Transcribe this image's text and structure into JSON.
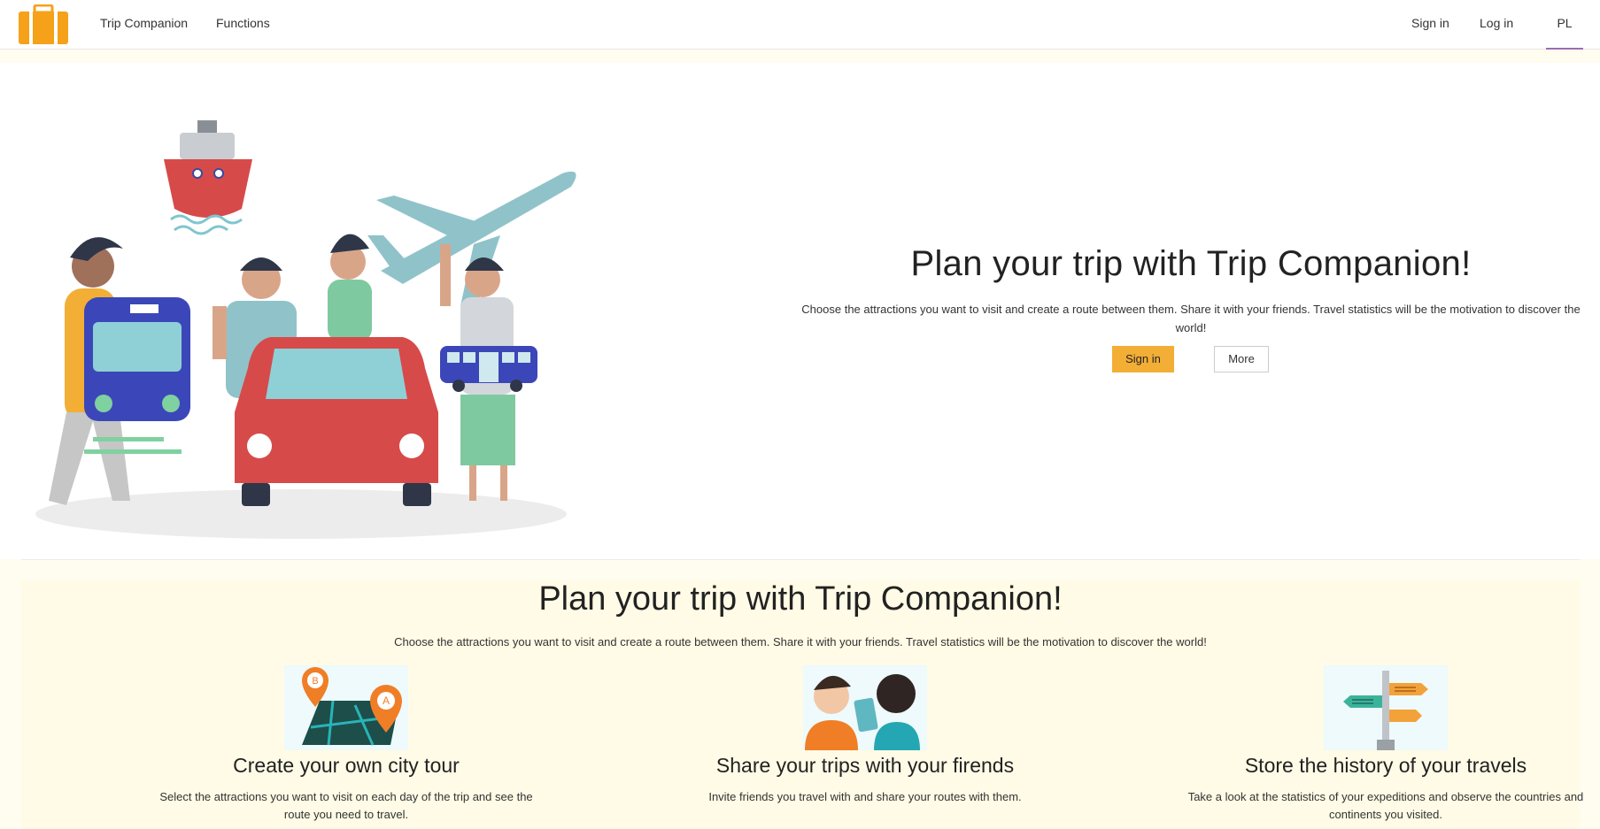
{
  "navbar": {
    "brand": "Trip Companion",
    "functions": "Functions",
    "sign_in": "Sign in",
    "log_in": "Log in",
    "language": "PL"
  },
  "hero": {
    "title": "Plan your trip with Trip Companion!",
    "description": "Choose the attractions you want to visit and create a route between them. Share it with your friends. Travel statistics will be the motivation to discover the world!",
    "sign_in_button": "Sign in",
    "more_button": "More"
  },
  "features": {
    "title": "Plan your trip with Trip Companion!",
    "description": "Choose the attractions you want to visit and create a route between them. Share it with your friends. Travel statistics will be the motivation to discover the world!",
    "items": [
      {
        "title": "Create your own city tour",
        "description": "Select the attractions you want to visit on each day of the trip and see the route you need to travel.",
        "icon": "map-pins-icon"
      },
      {
        "title": "Share your trips with your firends",
        "description": "Invite friends you travel with and share your routes with them.",
        "icon": "friends-sharing-icon"
      },
      {
        "title": "Store the history of your travels",
        "description": "Take a look at the statistics of your expeditions and observe the countries and continents you visited.",
        "icon": "signpost-icon"
      }
    ]
  },
  "colors": {
    "accent": "#f3ae35",
    "logo": "#f5a11a",
    "page_background": "#fffdf0",
    "features_background": "#fffbe6",
    "language_underline": "#a06ab4"
  }
}
